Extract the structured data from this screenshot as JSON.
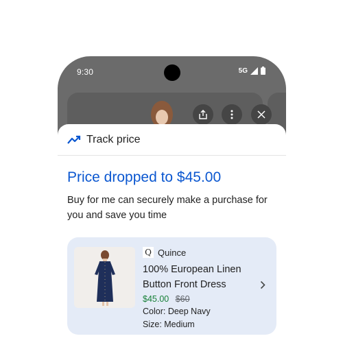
{
  "status_bar": {
    "time": "9:30",
    "network": "5G",
    "icons": [
      "signal-icon",
      "battery-icon"
    ]
  },
  "background_actions": {
    "icons": [
      "share-icon",
      "more-vert-icon",
      "close-icon"
    ]
  },
  "sheet": {
    "header_icon": "trending-icon",
    "title": "Track price",
    "headline": "Price dropped to $45.00",
    "description": "Buy for me can securely make a purchase for you and save you time"
  },
  "product": {
    "brand_logo": "Q",
    "brand": "Quince",
    "name": "100% European Linen Button Front Dress",
    "price_current": "$45.00",
    "price_original": "$60",
    "color": "Color: Deep Navy",
    "size": "Size: Medium"
  },
  "colors": {
    "accent_blue": "#0b57d0",
    "price_green": "#188038",
    "card_bg": "#e4ebf7",
    "phone_bg": "#6b6b6b"
  }
}
